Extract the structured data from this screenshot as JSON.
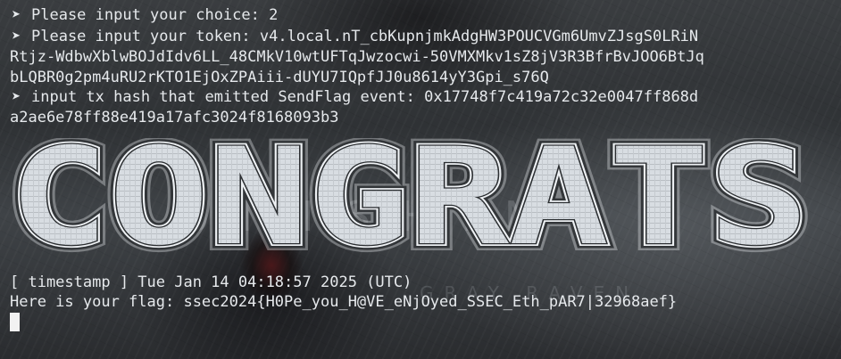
{
  "terminal": {
    "prompt_glyph": "➤",
    "choice_prompt": "Please input your choice: 2",
    "token_prompt_line1": "Please input your token: v4.local.nT_cbKupnjmkAdgHW3POUCVGm6UmvZJsgS0LRiN",
    "token_line2": "Rtjz-WdbwXblwBOJdIdv6LL_48CMkV10wtUFTqJwzocwi-50VMXMkv1sZ8jV3R3BfrBvJOO6BtJq",
    "token_line3": "bLQBR0g2pm4uRU2rKTO1EjOxZPAiii-dUYU7IQpfJJ0u8614yY3Gpi_s76Q",
    "tx_prompt_line1": "input tx hash that emitted SendFlag event: 0x17748f7c419a72c32e0047ff868d",
    "tx_line2": "a2ae6e78ff88e419a17afc3024f8168093b3",
    "banner_text": "CONGRATS",
    "timestamp_line": "[ timestamp ] Tue Jan 14 04:18:57 2025 (UTC)",
    "flag_line": "Here is your flag: ssec2024{H0Pe_you_H@VE_eNjOyed_SSEC_Eth_pAR7|32968aef}"
  },
  "colors": {
    "text": "#e6e9ec",
    "banner_fill": "#d8dde2",
    "banner_outline": "#eef1f4",
    "cursor": "#f2f2f2"
  }
}
